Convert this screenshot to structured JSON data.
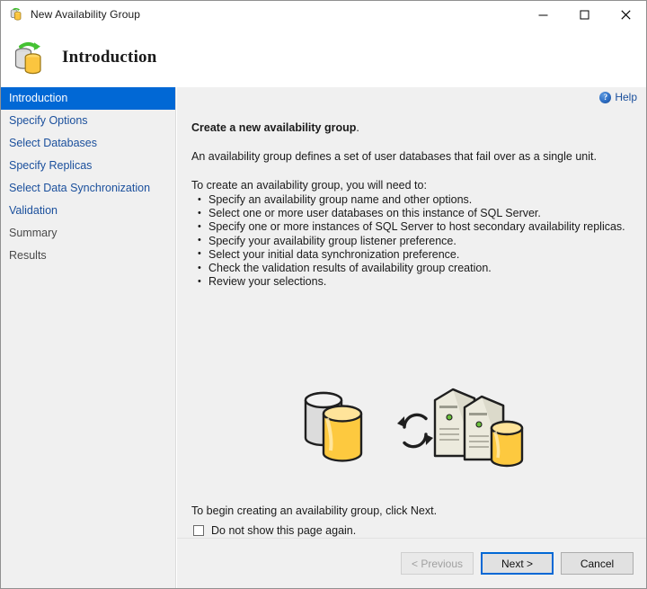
{
  "window": {
    "title": "New Availability Group",
    "icon": "availability-group-icon",
    "controls": {
      "minimize": "–",
      "maximize": "☐",
      "close": "✕"
    }
  },
  "header": {
    "title": "Introduction",
    "icon": "database-sync-icon"
  },
  "sidebar": {
    "items": [
      {
        "label": "Introduction",
        "state": "selected"
      },
      {
        "label": "Specify Options",
        "state": "link"
      },
      {
        "label": "Select Databases",
        "state": "link"
      },
      {
        "label": "Specify Replicas",
        "state": "link"
      },
      {
        "label": "Select Data Synchronization",
        "state": "link"
      },
      {
        "label": "Validation",
        "state": "link"
      },
      {
        "label": "Summary",
        "state": "disabled"
      },
      {
        "label": "Results",
        "state": "disabled"
      }
    ]
  },
  "help": {
    "label": "Help",
    "icon": "help-question-icon"
  },
  "main": {
    "lead_bold": "Create a new availability group",
    "lead_tail": ".",
    "definition": "An availability group defines a set of user databases that fail over as a single unit.",
    "needs_heading": "To create an availability group, you will need to:",
    "bullets": [
      "Specify an availability group name and other options.",
      "Select one or more user databases on this instance of SQL Server.",
      "Specify one or more instances of SQL Server to host secondary availability replicas.",
      "Specify your availability group listener preference.",
      "Select your initial data synchronization preference.",
      "Check the validation results of availability group creation.",
      "Review your selections."
    ],
    "begin_text": "To begin creating an availability group, click Next.",
    "checkbox_label": "Do not show this page again.",
    "checkbox_checked": false,
    "illustration": "databases-sync-servers-illustration"
  },
  "footer": {
    "previous": "< Previous",
    "next": "Next >",
    "cancel": "Cancel",
    "previous_enabled": false,
    "next_is_default": true
  },
  "colors": {
    "accent": "#0168d5",
    "link": "#1a4f9c",
    "panel": "#f0f0f0",
    "disabled_text": "#4a4a4a"
  }
}
